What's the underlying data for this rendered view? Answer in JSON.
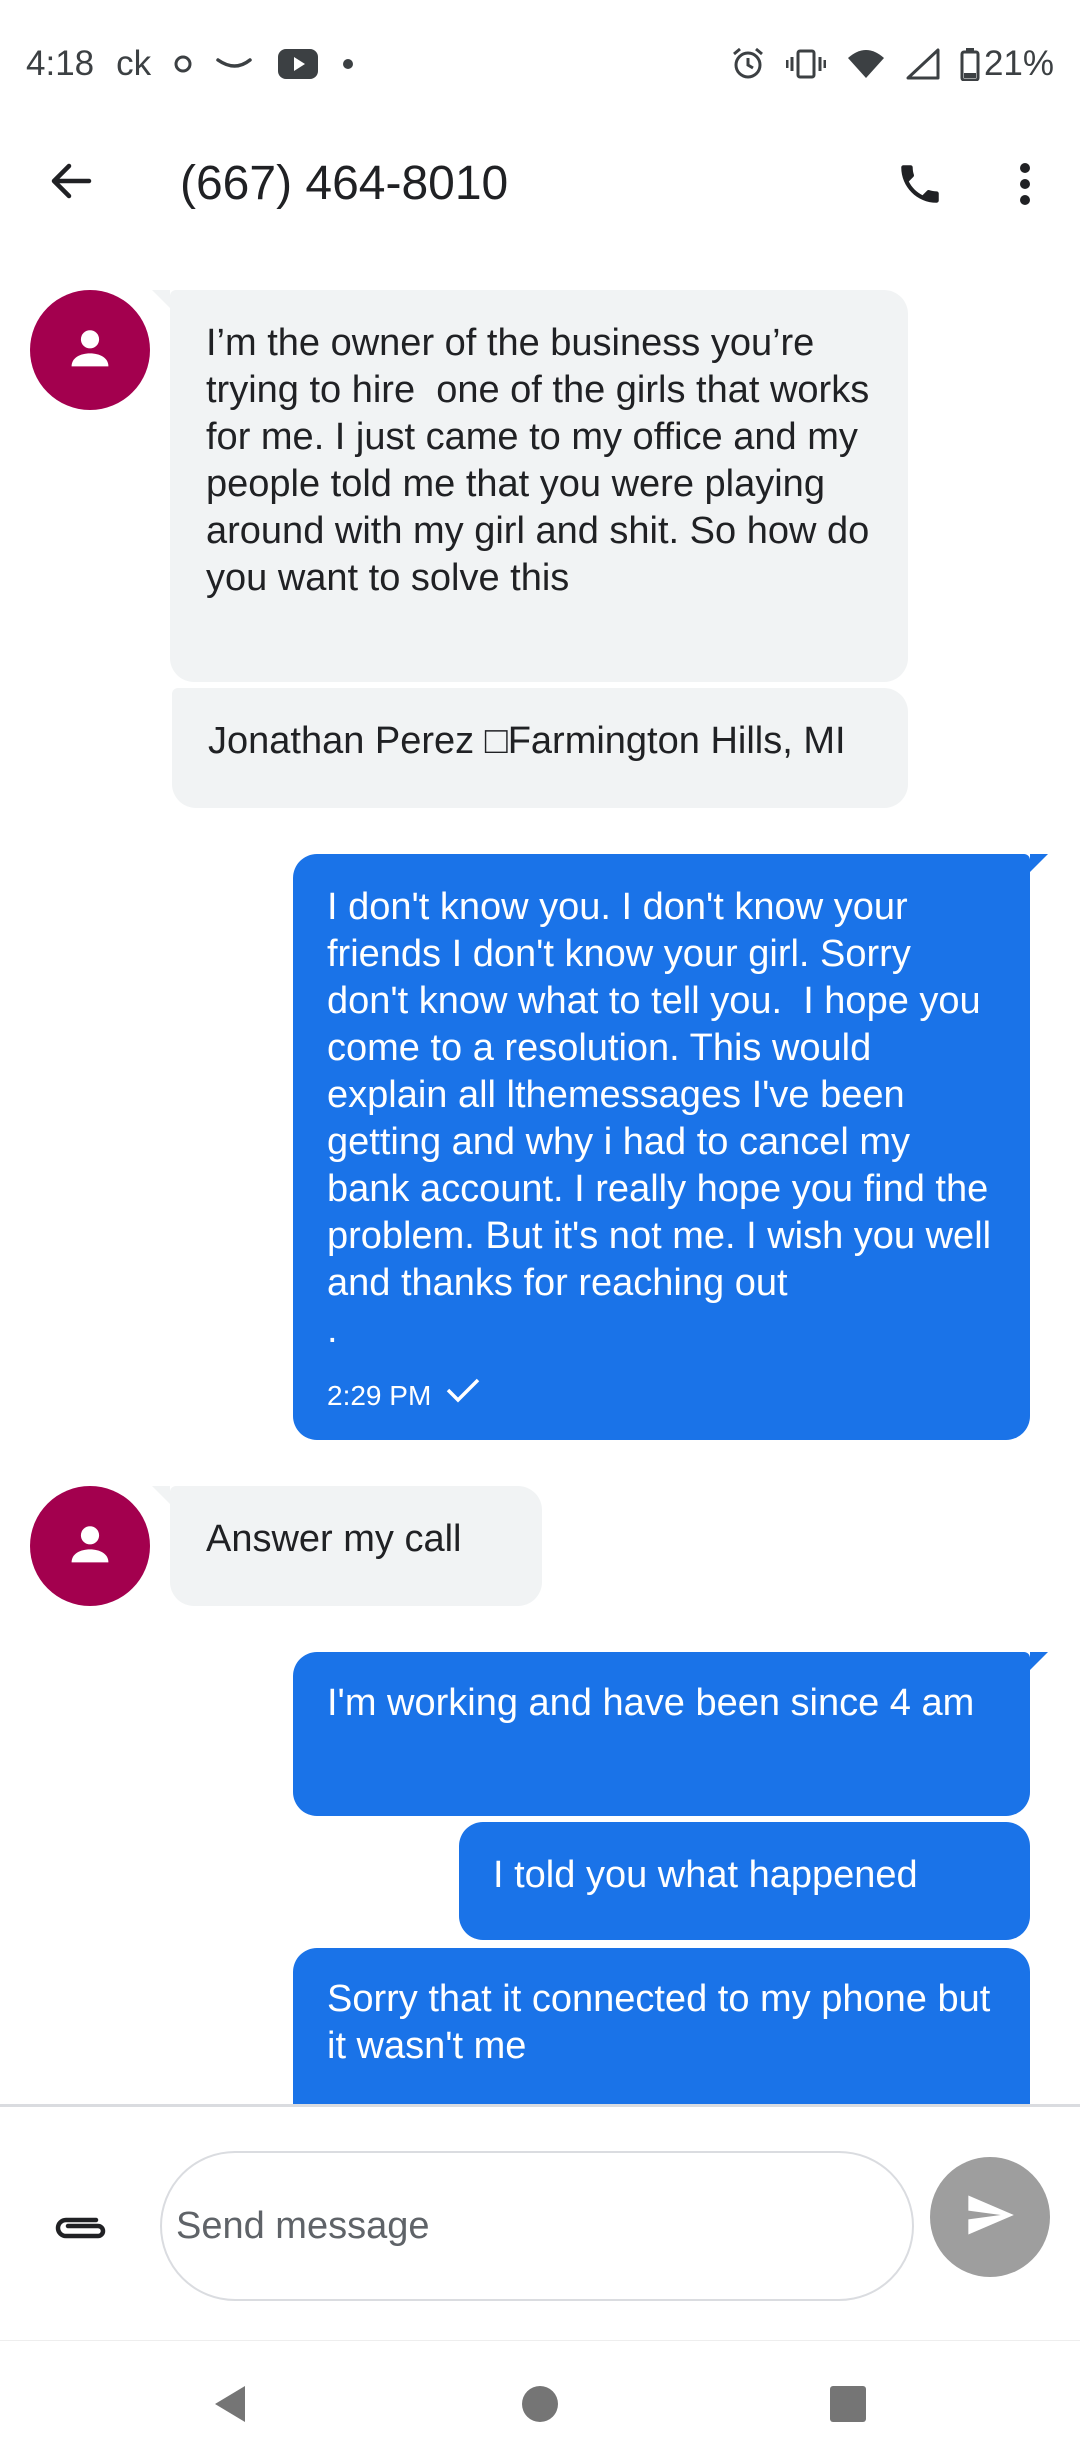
{
  "status_bar": {
    "time": "4:18",
    "carrier_tag": "ck",
    "battery": "21%",
    "icons": [
      "dot-icon",
      "amazon-smile-icon",
      "youtube-icon",
      "small-dot-icon",
      "alarm-icon",
      "vibrate-icon",
      "wifi-icon",
      "signal-icon",
      "battery-icon"
    ]
  },
  "header": {
    "title": "(667) 464-8010",
    "icons": [
      "back-arrow-icon",
      "phone-icon",
      "more-vert-icon"
    ]
  },
  "messages": [
    {
      "direction": "incoming",
      "text": "I’m the owner of the business you’re trying to hire  one of the girls that works for me. I just came to my office and my people told me that you were playing around with my girl and shit. So how do you want to solve this"
    },
    {
      "direction": "incoming",
      "text": "Jonathan Perez □Farmington Hills, MI"
    },
    {
      "direction": "outgoing",
      "text": "I don't know you. I don't know your friends I don't know your girl. Sorry don't know what to tell you.  I hope you come to a resolution. This would explain all lthemessages I've been getting and why i had to cancel my bank account. I really hope you find the problem. But it's not me. I wish you well and thanks for reaching out\n.",
      "time": "2:29 PM"
    },
    {
      "direction": "incoming",
      "text": "Answer my call"
    },
    {
      "direction": "outgoing",
      "text": "I'm working and have been since 4 am"
    },
    {
      "direction": "outgoing",
      "text": "I told you what happened"
    },
    {
      "direction": "outgoing",
      "text": "Sorry that it connected to my phone but it wasn't me"
    }
  ],
  "compose": {
    "placeholder": "Send message"
  },
  "colors": {
    "outgoing_bubble": "#1a73e8",
    "incoming_bubble": "#f1f3f4",
    "avatar": "#a3004e",
    "send_button": "#9e9e9e"
  }
}
